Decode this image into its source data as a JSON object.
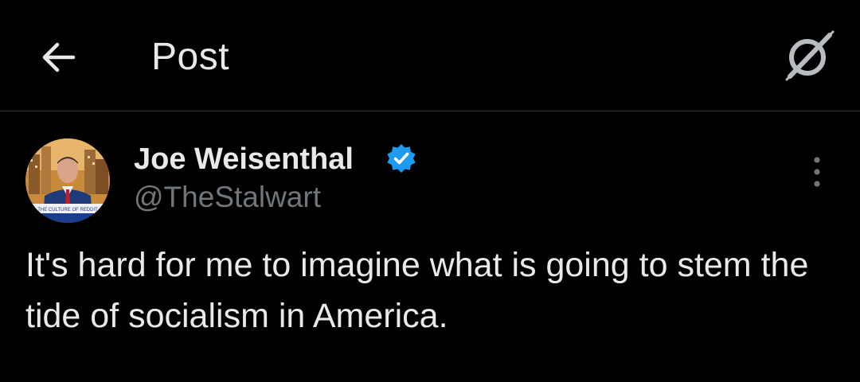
{
  "header": {
    "title": "Post",
    "back_icon": "arrow-left-icon",
    "grok_icon": "grok-icon"
  },
  "post": {
    "author": {
      "display_name": "Joe Weisenthal",
      "handle": "@TheStalwart",
      "verified": true,
      "verified_icon": "verified-badge-icon",
      "avatar_caption": "THE CULTURE OF REDDIT"
    },
    "more_icon": "more-vertical-icon",
    "text": "It's hard for me to imagine what is going to stem the tide of socialism in America."
  },
  "colors": {
    "background": "#000000",
    "text_primary": "#e7e9ea",
    "text_secondary": "#71767b",
    "divider": "#2f3336",
    "verified_blue": "#1d9bf0"
  }
}
